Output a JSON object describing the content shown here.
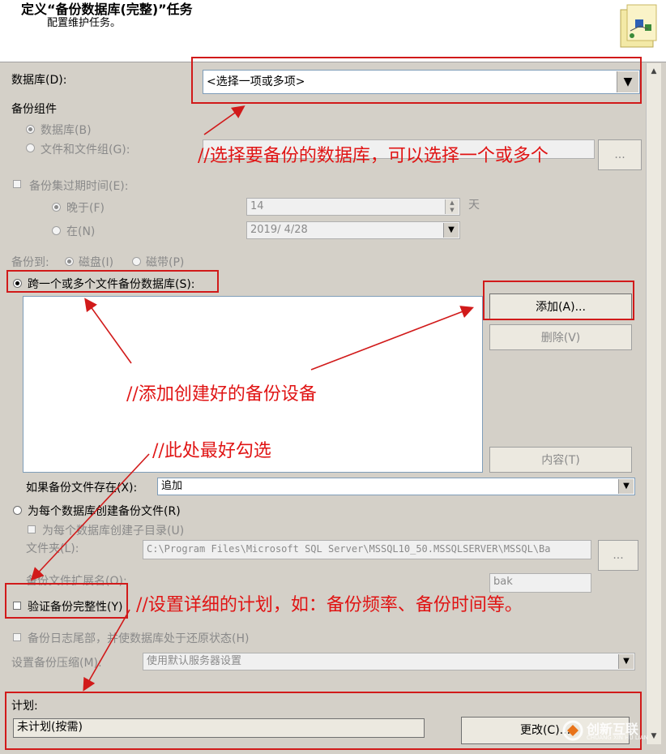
{
  "header": {
    "title": "定义“备份数据库(完整)”任务",
    "subtitle": "配置维护任务。",
    "icon": "maintenance-task-icon"
  },
  "database": {
    "label": "数据库(D):",
    "value": "<选择一项或多项>"
  },
  "backup_component": {
    "label": "备份组件",
    "database_option": "数据库(B)",
    "files_option": "文件和文件组(G):",
    "files_browse": "..."
  },
  "expire": {
    "checkbox_label": "备份集过期时间(E):",
    "after_label": "晚于(F)",
    "after_value": "14",
    "after_unit": "天",
    "on_label": "在(N)",
    "on_value": "2019/ 4/28"
  },
  "backup_to": {
    "label": "备份到:",
    "disk": "磁盘(I)",
    "tape": "磁带(P)"
  },
  "span_files": {
    "label": "跨一个或多个文件备份数据库(S):",
    "add_button": "添加(A)...",
    "remove_button": "删除(V)",
    "contents_button": "内容(T)"
  },
  "if_exists": {
    "label": "如果备份文件存在(X):",
    "value": "追加"
  },
  "per_database": {
    "label": "为每个数据库创建备份文件(R)",
    "subdir_label": "为每个数据库创建子目录(U)",
    "folder_label": "文件夹(L):",
    "folder_value": "C:\\Program Files\\Microsoft SQL Server\\MSSQL10_50.MSSQLSERVER\\MSSQL\\Ba",
    "folder_browse": "...",
    "ext_label": "备份文件扩展名(O):",
    "ext_value": "bak"
  },
  "verify": {
    "label": "验证备份完整性(Y)"
  },
  "tail_log": {
    "label": "备份日志尾部，并使数据库处于还原状态(H)"
  },
  "compression": {
    "label": "设置备份压缩(M):",
    "value": "使用默认服务器设置"
  },
  "schedule": {
    "label": "计划:",
    "value": "未计划(按需)",
    "change_button": "更改(C)..."
  },
  "annotations": {
    "select_db": "//选择要备份的数据库，可以选择一个或多个",
    "add_device": "//添加创建好的备份设备",
    "best_check": "//此处最好勾选",
    "schedule_detail": "//设置详细的计划，如：备份频率、备份时间等。"
  },
  "watermark": {
    "name": "创新互联",
    "subtext": "CHUANG XIN HU LIAN"
  },
  "colors": {
    "annotation_red": "#e01414",
    "dialog_bg": "#d4d0c8",
    "field_border": "#7f9db9"
  }
}
